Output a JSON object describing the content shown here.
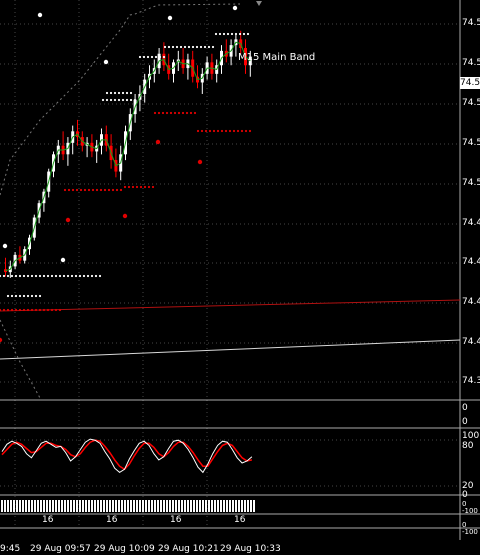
{
  "price_axis": [
    "74.5",
    "74.5",
    "74.5",
    "74.5",
    "74.5",
    "74.4",
    "74.4",
    "74.4",
    "74.4",
    "74.3"
  ],
  "current_price": "74.5",
  "band_label": "M15 Main Band",
  "indicator1_scale": [
    "0",
    "0"
  ],
  "osc_scale": [
    "100",
    "80",
    "20",
    "0"
  ],
  "indicator3_scale": [
    "0",
    "-100",
    "0",
    "-100"
  ],
  "sub_labels": [
    "16",
    "16",
    "16",
    "16"
  ],
  "time_axis": [
    "9:45",
    "29 Aug 09:57",
    "29 Aug 10:09",
    "29 Aug 10:21",
    "29 Aug 10:33"
  ],
  "colors": {
    "bull": "#ffffff",
    "bear": "#ff0000",
    "grid": "#ffffff",
    "signal": "#ff0000"
  },
  "chart_data": {
    "type": "candlestick",
    "candles": [
      [
        74.43,
        74.438,
        74.425,
        74.428
      ],
      [
        74.428,
        74.436,
        74.424,
        74.432
      ],
      [
        74.432,
        74.442,
        74.43,
        74.44
      ],
      [
        74.44,
        74.446,
        74.434,
        74.436
      ],
      [
        74.436,
        74.446,
        74.434,
        74.444
      ],
      [
        74.444,
        74.454,
        74.44,
        74.452
      ],
      [
        74.452,
        74.468,
        74.45,
        74.466
      ],
      [
        74.466,
        74.478,
        74.462,
        74.476
      ],
      [
        74.476,
        74.486,
        74.47,
        74.484
      ],
      [
        74.484,
        74.5,
        74.48,
        74.498
      ],
      [
        74.498,
        74.512,
        74.494,
        74.51
      ],
      [
        74.51,
        74.52,
        74.504,
        74.516
      ],
      [
        74.516,
        74.526,
        74.506,
        74.51
      ],
      [
        74.51,
        74.522,
        74.502,
        74.518
      ],
      [
        74.518,
        74.53,
        74.51,
        74.526
      ],
      [
        74.526,
        74.534,
        74.516,
        74.522
      ],
      [
        74.522,
        74.526,
        74.512,
        74.516
      ],
      [
        74.516,
        74.522,
        74.508,
        74.518
      ],
      [
        74.518,
        74.524,
        74.508,
        74.512
      ],
      [
        74.512,
        74.52,
        74.504,
        74.516
      ],
      [
        74.516,
        74.528,
        74.51,
        74.524
      ],
      [
        74.524,
        74.53,
        74.512,
        74.516
      ],
      [
        74.516,
        74.524,
        74.5,
        74.506
      ],
      [
        74.506,
        74.514,
        74.494,
        74.498
      ],
      [
        74.498,
        74.516,
        74.492,
        74.51
      ],
      [
        74.51,
        74.53,
        74.506,
        74.526
      ],
      [
        74.526,
        74.542,
        74.52,
        74.538
      ],
      [
        74.538,
        74.552,
        74.532,
        74.548
      ],
      [
        74.548,
        74.558,
        74.54,
        74.552
      ],
      [
        74.552,
        74.566,
        74.546,
        74.562
      ],
      [
        74.562,
        74.572,
        74.556,
        74.566
      ],
      [
        74.566,
        74.576,
        74.56,
        74.57
      ],
      [
        74.57,
        74.584,
        74.566,
        74.58
      ],
      [
        74.58,
        74.588,
        74.568,
        74.572
      ],
      [
        74.572,
        74.58,
        74.562,
        74.566
      ],
      [
        74.566,
        74.576,
        74.56,
        74.574
      ],
      [
        74.574,
        74.582,
        74.568,
        74.576
      ],
      [
        74.576,
        74.584,
        74.566,
        74.57
      ],
      [
        74.57,
        74.58,
        74.562,
        74.576
      ],
      [
        74.576,
        74.582,
        74.56,
        74.564
      ],
      [
        74.564,
        74.572,
        74.556,
        74.56
      ],
      [
        74.56,
        74.57,
        74.552,
        74.566
      ],
      [
        74.566,
        74.578,
        74.562,
        74.574
      ],
      [
        74.574,
        74.58,
        74.562,
        74.566
      ],
      [
        74.566,
        74.576,
        74.56,
        74.572
      ],
      [
        74.572,
        74.586,
        74.566,
        74.582
      ],
      [
        74.582,
        74.59,
        74.574,
        74.578
      ],
      [
        74.578,
        74.59,
        74.572,
        74.586
      ],
      [
        74.586,
        74.594,
        74.578,
        74.59
      ],
      [
        74.59,
        74.596,
        74.58,
        74.584
      ],
      [
        74.584,
        74.59,
        74.566,
        74.572
      ],
      [
        74.572,
        74.582,
        74.564,
        74.578
      ]
    ],
    "stochastic_main": [
      70,
      84,
      90,
      86,
      80,
      66,
      58,
      72,
      86,
      90,
      84,
      78,
      80,
      68,
      52,
      60,
      74,
      88,
      94,
      92,
      86,
      70,
      56,
      38,
      30,
      36,
      56,
      72,
      86,
      90,
      82,
      66,
      54,
      60,
      76,
      90,
      92,
      86,
      74,
      58,
      40,
      30,
      46,
      66,
      82,
      90,
      88,
      74,
      58,
      48,
      52,
      60
    ],
    "stochastic_signal": [
      64,
      74,
      84,
      88,
      84,
      76,
      68,
      70,
      78,
      86,
      86,
      82,
      80,
      74,
      64,
      60,
      66,
      78,
      88,
      92,
      90,
      80,
      68,
      54,
      42,
      36,
      46,
      62,
      76,
      86,
      86,
      78,
      66,
      60,
      68,
      80,
      88,
      88,
      80,
      68,
      54,
      42,
      42,
      56,
      70,
      82,
      86,
      82,
      70,
      58,
      52,
      54
    ]
  }
}
